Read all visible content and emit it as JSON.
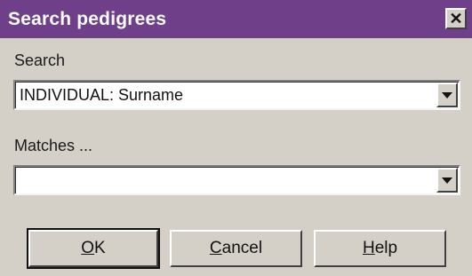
{
  "window": {
    "title": "Search pedigrees",
    "close_glyph": "✕"
  },
  "search": {
    "label": "Search",
    "value": "INDIVIDUAL: Surname"
  },
  "matches": {
    "label": "Matches ...",
    "value": ""
  },
  "buttons": {
    "ok": {
      "mnemonic": "O",
      "rest": "K"
    },
    "cancel": {
      "mnemonic": "C",
      "rest": "ancel"
    },
    "help": {
      "mnemonic": "H",
      "rest": "elp"
    }
  },
  "colors": {
    "titlebar": "#6f3f8a",
    "dialog_bg": "#d4d0c8"
  },
  "icons": {
    "close": "close-icon",
    "dropdown": "chevron-down-icon"
  }
}
